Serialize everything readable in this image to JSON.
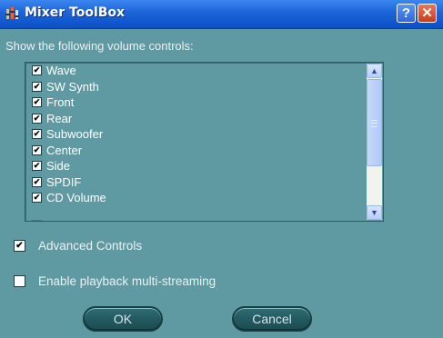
{
  "window": {
    "title": "Mixer ToolBox",
    "help_label": "?",
    "close_label": "✕"
  },
  "prompt": "Show the following volume controls:",
  "controls": [
    {
      "label": "Wave",
      "checked": true
    },
    {
      "label": "SW Synth",
      "checked": true
    },
    {
      "label": "Front",
      "checked": true
    },
    {
      "label": "Rear",
      "checked": true
    },
    {
      "label": "Subwoofer",
      "checked": true
    },
    {
      "label": "Center",
      "checked": true
    },
    {
      "label": "Side",
      "checked": true
    },
    {
      "label": "SPDIF",
      "checked": true
    },
    {
      "label": "CD Volume",
      "checked": true
    }
  ],
  "options": {
    "advanced": {
      "label": "Advanced Controls",
      "checked": true
    },
    "multistream": {
      "label": "Enable playback multi-streaming",
      "checked": false
    }
  },
  "buttons": {
    "ok": "OK",
    "cancel": "Cancel"
  }
}
